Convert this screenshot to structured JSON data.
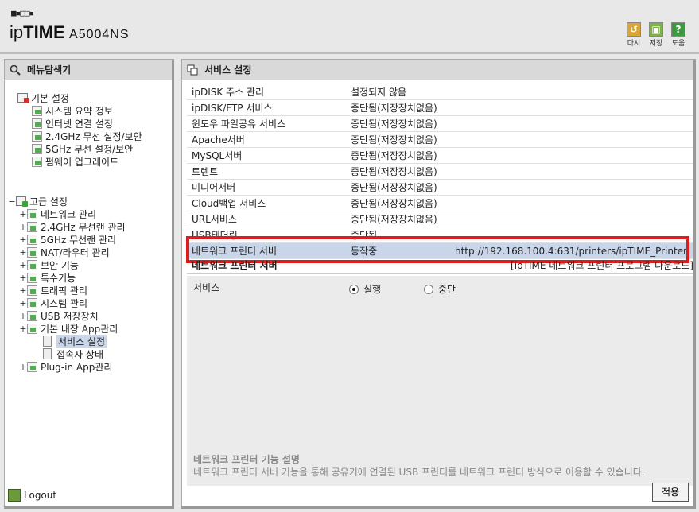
{
  "header": {
    "logo_dots": "■▪□□▪",
    "logo_ip": "ip",
    "logo_time": "TIME",
    "model": "A5004NS",
    "tools": [
      {
        "name": "refresh",
        "label": "다시",
        "color": "#d9a635",
        "glyph": "↺"
      },
      {
        "name": "save",
        "label": "저장",
        "color": "#7fb24a",
        "glyph": "▣"
      },
      {
        "name": "help",
        "label": "도움",
        "color": "#3f9a3f",
        "glyph": "?"
      }
    ]
  },
  "left": {
    "title": "메뉴탐색기",
    "basic": {
      "label": "기본 설정",
      "items": [
        "시스템 요약 정보",
        "인터넷 연결 설정",
        "2.4GHz 무선 설정/보안",
        "5GHz 무선 설정/보안",
        "펌웨어 업그레이드"
      ]
    },
    "advanced": {
      "expander": "−",
      "label": "고급 설정",
      "items": [
        {
          "exp": "+",
          "label": "네트워크 관리"
        },
        {
          "exp": "+",
          "label": "2.4GHz 무선랜 관리"
        },
        {
          "exp": "+",
          "label": "5GHz 무선랜 관리"
        },
        {
          "exp": "+",
          "label": "NAT/라우터 관리"
        },
        {
          "exp": "+",
          "label": "보안 기능"
        },
        {
          "exp": "+",
          "label": "특수기능"
        },
        {
          "exp": "+",
          "label": "트래픽 관리"
        },
        {
          "exp": "+",
          "label": "시스템 관리"
        },
        {
          "exp": "+",
          "label": "USB 저장장치"
        },
        {
          "exp": "+",
          "label": "기본 내장 App관리"
        }
      ],
      "app_children": [
        "서비스 설정",
        "접속자 상태"
      ],
      "plugin": {
        "exp": "+",
        "label": "Plug-in App관리"
      }
    },
    "logout": "Logout"
  },
  "right": {
    "title": "서비스 설정",
    "services": [
      {
        "name": "ipDISK 주소 관리",
        "status": "설정되지 않음",
        "extra": ""
      },
      {
        "name": "ipDISK/FTP 서비스",
        "status": "중단됨(저장장치없음)",
        "extra": ""
      },
      {
        "name": "윈도우 파일공유 서비스",
        "status": "중단됨(저장장치없음)",
        "extra": ""
      },
      {
        "name": "Apache서버",
        "status": "중단됨(저장장치없음)",
        "extra": ""
      },
      {
        "name": "MySQL서버",
        "status": "중단됨(저장장치없음)",
        "extra": ""
      },
      {
        "name": "토렌트",
        "status": "중단됨(저장장치없음)",
        "extra": ""
      },
      {
        "name": "미디어서버",
        "status": "중단됨(저장장치없음)",
        "extra": ""
      },
      {
        "name": "Cloud백업 서비스",
        "status": "중단됨(저장장치없음)",
        "extra": ""
      },
      {
        "name": "URL서비스",
        "status": "중단됨(저장장치없음)",
        "extra": ""
      },
      {
        "name": "USB테더링",
        "status": "중단됨",
        "extra": ""
      },
      {
        "name": "네트워크 프린터 서버",
        "status": "동작중",
        "extra": "http://192.168.100.4:631/printers/ipTIME_Printer"
      }
    ],
    "detail_title": "네트워크 프린터 서버",
    "detail_link": "[ipTIME 네트워크 프린터 프로그램 다운로드]",
    "service_label": "서비스",
    "radio_run": "실행",
    "radio_stop": "중단",
    "desc_title": "네트워크 프린터 기능 설명",
    "desc_text": "네트워크 프린터 서버 기능을 통해 공유기에 연결된 USB 프린터를 네트워크 프린터 방식으로 이용할 수 있습니다.",
    "apply": "적용"
  }
}
